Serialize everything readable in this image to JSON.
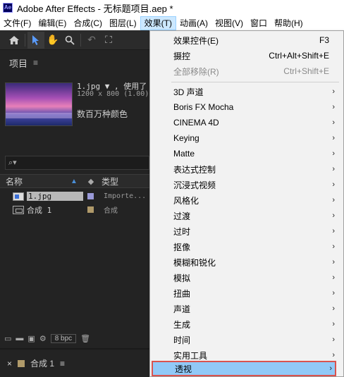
{
  "window": {
    "app_icon": "Ae",
    "title": "Adobe After Effects - 无标题项目.aep *"
  },
  "menubar": {
    "items": [
      "文件(F)",
      "编辑(E)",
      "合成(C)",
      "图层(L)",
      "效果(T)",
      "动画(A)",
      "视图(V)",
      "窗口",
      "帮助(H)"
    ]
  },
  "toolbar": {
    "tools": [
      "home-icon",
      "selection-arrow-icon",
      "hand-icon",
      "zoom-icon",
      "rotate-icon",
      "camera-orbit-icon"
    ]
  },
  "project": {
    "title": "项目",
    "menu_icon": "≡",
    "file_name": "1.jpg ▼ , 使用了",
    "file_meta": "1200 x 800 (1.00)",
    "file_color": "数百万种颜色",
    "search_icon": "⌕▾",
    "columns": {
      "name": "名称",
      "type": "类型"
    },
    "rows": [
      {
        "name": "1.jpg",
        "type": "Importe...",
        "swatch": "#9a9ad8"
      },
      {
        "name": "合成 1",
        "type": "合成",
        "swatch": "#b09a6a"
      }
    ],
    "footer_bpc": "8 bpc"
  },
  "composition_tab": {
    "close": "×",
    "label": "合成 1",
    "menu_icon": "≡"
  },
  "effects_menu": {
    "items": [
      {
        "label": "效果控件(E)",
        "shortcut": "F3",
        "submenu": false,
        "disabled": false
      },
      {
        "label": "摄控",
        "shortcut": "Ctrl+Alt+Shift+E",
        "submenu": false,
        "disabled": false
      },
      {
        "label": "全部移除(R)",
        "shortcut": "Ctrl+Shift+E",
        "submenu": false,
        "disabled": true
      },
      {
        "label": "3D 声道",
        "shortcut": "",
        "submenu": true,
        "disabled": false
      },
      {
        "label": "Boris FX Mocha",
        "shortcut": "",
        "submenu": true,
        "disabled": false
      },
      {
        "label": "CINEMA 4D",
        "shortcut": "",
        "submenu": true,
        "disabled": false
      },
      {
        "label": "Keying",
        "shortcut": "",
        "submenu": true,
        "disabled": false
      },
      {
        "label": "Matte",
        "shortcut": "",
        "submenu": true,
        "disabled": false
      },
      {
        "label": "表达式控制",
        "shortcut": "",
        "submenu": true,
        "disabled": false
      },
      {
        "label": "沉浸式视频",
        "shortcut": "",
        "submenu": true,
        "disabled": false
      },
      {
        "label": "风格化",
        "shortcut": "",
        "submenu": true,
        "disabled": false
      },
      {
        "label": "过渡",
        "shortcut": "",
        "submenu": true,
        "disabled": false
      },
      {
        "label": "过时",
        "shortcut": "",
        "submenu": true,
        "disabled": false
      },
      {
        "label": "抠像",
        "shortcut": "",
        "submenu": true,
        "disabled": false
      },
      {
        "label": "模糊和锐化",
        "shortcut": "",
        "submenu": true,
        "disabled": false
      },
      {
        "label": "模拟",
        "shortcut": "",
        "submenu": true,
        "disabled": false
      },
      {
        "label": "扭曲",
        "shortcut": "",
        "submenu": true,
        "disabled": false
      },
      {
        "label": "声道",
        "shortcut": "",
        "submenu": true,
        "disabled": false
      },
      {
        "label": "生成",
        "shortcut": "",
        "submenu": true,
        "disabled": false
      },
      {
        "label": "时间",
        "shortcut": "",
        "submenu": true,
        "disabled": false
      },
      {
        "label": "实用工具",
        "shortcut": "",
        "submenu": true,
        "disabled": false
      },
      {
        "label": "透视",
        "shortcut": "",
        "submenu": true,
        "disabled": false,
        "highlighted": true
      }
    ]
  },
  "colors": {
    "highlight_bg": "#91c9f7",
    "highlight_border": "#d9534f",
    "active_menu_bg": "#cce8ff"
  }
}
